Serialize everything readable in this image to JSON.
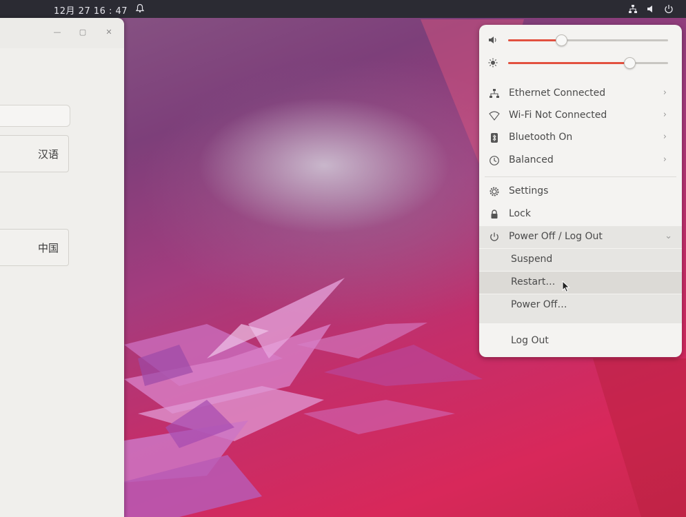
{
  "topbar": {
    "clock": "12月 27  16 : 47",
    "icons": [
      "alarm-bell-icon",
      "network-icon",
      "volume-icon",
      "power-icon"
    ]
  },
  "left_window": {
    "controls": [
      "minimize-icon",
      "maximize-icon",
      "close-icon"
    ],
    "language_value": "汉语",
    "region_value": "中国"
  },
  "system_menu": {
    "volume_level": 0.33,
    "brightness_level": 0.76,
    "accent_color": "#e2503f",
    "items": [
      {
        "label": "Ethernet Connected",
        "icon": "network-wired-icon",
        "has_submenu": true
      },
      {
        "label": "Wi-Fi Not Connected",
        "icon": "wifi-icon",
        "has_submenu": true
      },
      {
        "label": "Bluetooth On",
        "icon": "bluetooth-icon",
        "has_submenu": true
      },
      {
        "label": "Balanced",
        "icon": "power-profile-icon",
        "has_submenu": true
      }
    ],
    "settings_label": "Settings",
    "lock_label": "Lock",
    "power_label": "Power Off / Log Out",
    "power_submenu": {
      "suspend": "Suspend",
      "restart": "Restart…",
      "power_off": "Power Off…",
      "log_out": "Log Out"
    }
  }
}
